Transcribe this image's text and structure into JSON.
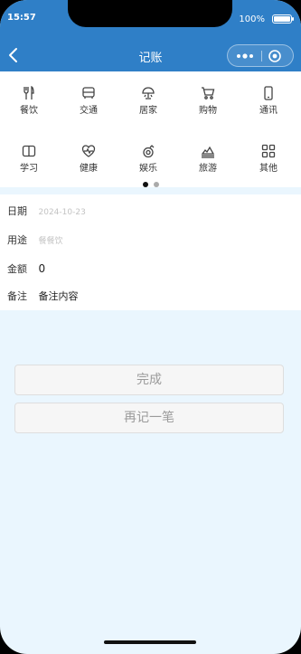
{
  "status": {
    "time": "15:57",
    "battery": "100%"
  },
  "nav": {
    "title": "记账"
  },
  "categories": [
    {
      "label": "餐饮",
      "icon": "utensils-icon"
    },
    {
      "label": "交通",
      "icon": "bus-icon"
    },
    {
      "label": "居家",
      "icon": "lamp-icon"
    },
    {
      "label": "购物",
      "icon": "cart-icon"
    },
    {
      "label": "通讯",
      "icon": "phone-icon"
    },
    {
      "label": "学习",
      "icon": "book-icon"
    },
    {
      "label": "健康",
      "icon": "heart-pulse-icon"
    },
    {
      "label": "娱乐",
      "icon": "game-icon"
    },
    {
      "label": "旅游",
      "icon": "travel-icon"
    },
    {
      "label": "其他",
      "icon": "grid-icon"
    }
  ],
  "pager": {
    "pages": 2,
    "current": 1
  },
  "form": {
    "date_label": "日期",
    "date_value": "2024-10-23",
    "purpose_label": "用途",
    "purpose_value": "餐餐饮",
    "amount_label": "金额",
    "amount_value": "0",
    "note_label": "备注",
    "note_value": "备注内容"
  },
  "buttons": {
    "done": "完成",
    "again": "再记一笔"
  },
  "colors": {
    "header": "#2f7fc7",
    "page_bg": "#eaf6fe"
  }
}
